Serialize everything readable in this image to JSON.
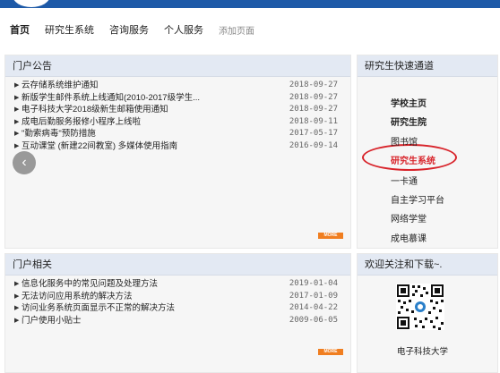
{
  "nav": {
    "items": [
      {
        "label": "首页"
      },
      {
        "label": "研究生系统"
      },
      {
        "label": "咨询服务"
      },
      {
        "label": "个人服务"
      },
      {
        "label": "添加页面"
      }
    ]
  },
  "announcements": {
    "title": "门户公告",
    "items": [
      {
        "text": "云存储系统维护通知",
        "date": "2018-09-27"
      },
      {
        "text": "新版学生邮件系统上线通知(2010-2017级学生...",
        "date": "2018-09-27"
      },
      {
        "text": "电子科技大学2018级新生邮箱使用通知",
        "date": "2018-09-27"
      },
      {
        "text": "成电后勤服务报修小程序上线啦",
        "date": "2018-09-11"
      },
      {
        "text": "\"勤索病毒\"预防措施",
        "date": "2017-05-17"
      },
      {
        "text": "互动课堂 (新建22间教室) 多媒体使用指南",
        "date": "2016-09-14"
      }
    ],
    "more": "MORE"
  },
  "related": {
    "title": "门户相关",
    "items": [
      {
        "text": "信息化服务中的常见问题及处理方法",
        "date": "2019-01-04"
      },
      {
        "text": "无法访问应用系统的解决方法",
        "date": "2017-01-09"
      },
      {
        "text": "访问业务系统页面显示不正常的解决方法",
        "date": "2014-04-22"
      },
      {
        "text": "门户使用小贴士",
        "date": "2009-06-05"
      }
    ],
    "more": "MORE"
  },
  "quick_links": {
    "title": "研究生快速通道",
    "items": [
      {
        "label": "学校主页"
      },
      {
        "label": "研究生院"
      },
      {
        "label": "图书馆"
      },
      {
        "label": "研究生系统"
      },
      {
        "label": "一卡通"
      },
      {
        "label": "自主学习平台"
      },
      {
        "label": "网络学堂"
      },
      {
        "label": "成电慕课"
      }
    ]
  },
  "follow": {
    "title": "欢迎关注和下载~.",
    "caption": "电子科技大学"
  },
  "icons": {
    "prev": "chevron-left-icon",
    "bullet": "triangle-bullet-icon"
  },
  "colors": {
    "accent": "#1e5aa8",
    "highlight": "#d8232a",
    "more_badge": "#f07e20"
  }
}
